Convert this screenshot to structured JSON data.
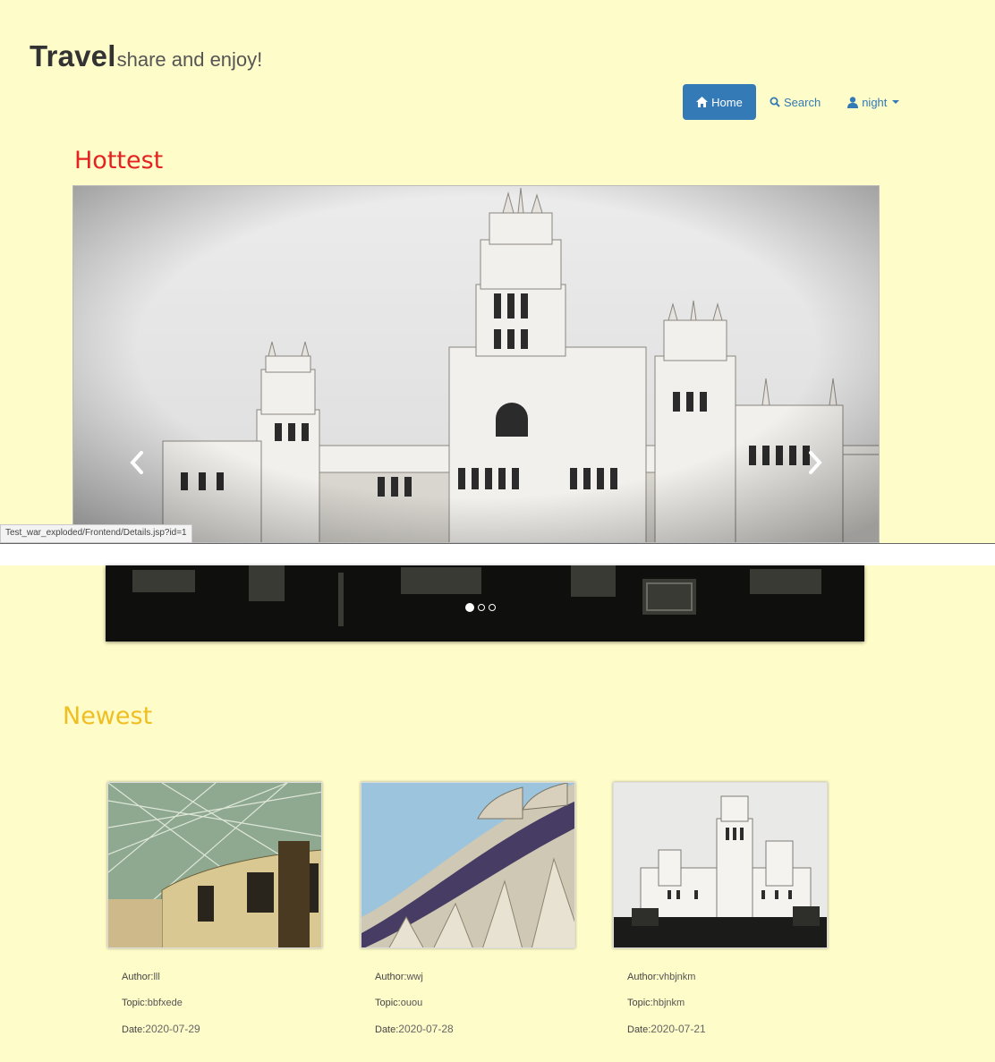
{
  "brand": {
    "title": "Travel",
    "tagline": "share and enjoy!"
  },
  "nav": {
    "home": "Home",
    "search": "Search",
    "user": "night"
  },
  "sections": {
    "hottest": "Hottest",
    "newest": "Newest"
  },
  "carousel": {
    "slide_count": 3,
    "active_index": 0
  },
  "status_bar": {
    "url": "Test_war_exploded/Frontend/Details.jsp?id=1"
  },
  "labels": {
    "author": "Author:",
    "topic": "Topic:",
    "date": "Date:"
  },
  "cards": [
    {
      "author": "lll",
      "topic": "bbfxede",
      "date": "2020-07-29"
    },
    {
      "author": "wwj",
      "topic": "ouou",
      "date": "2020-07-28"
    },
    {
      "author": "vhbjnkm",
      "topic": "hbjnkm",
      "date": "2020-07-21"
    }
  ],
  "colors": {
    "background": "#fefcc8",
    "hottest": "#e42222",
    "newest": "#efbe22",
    "accent": "#337ab7"
  }
}
